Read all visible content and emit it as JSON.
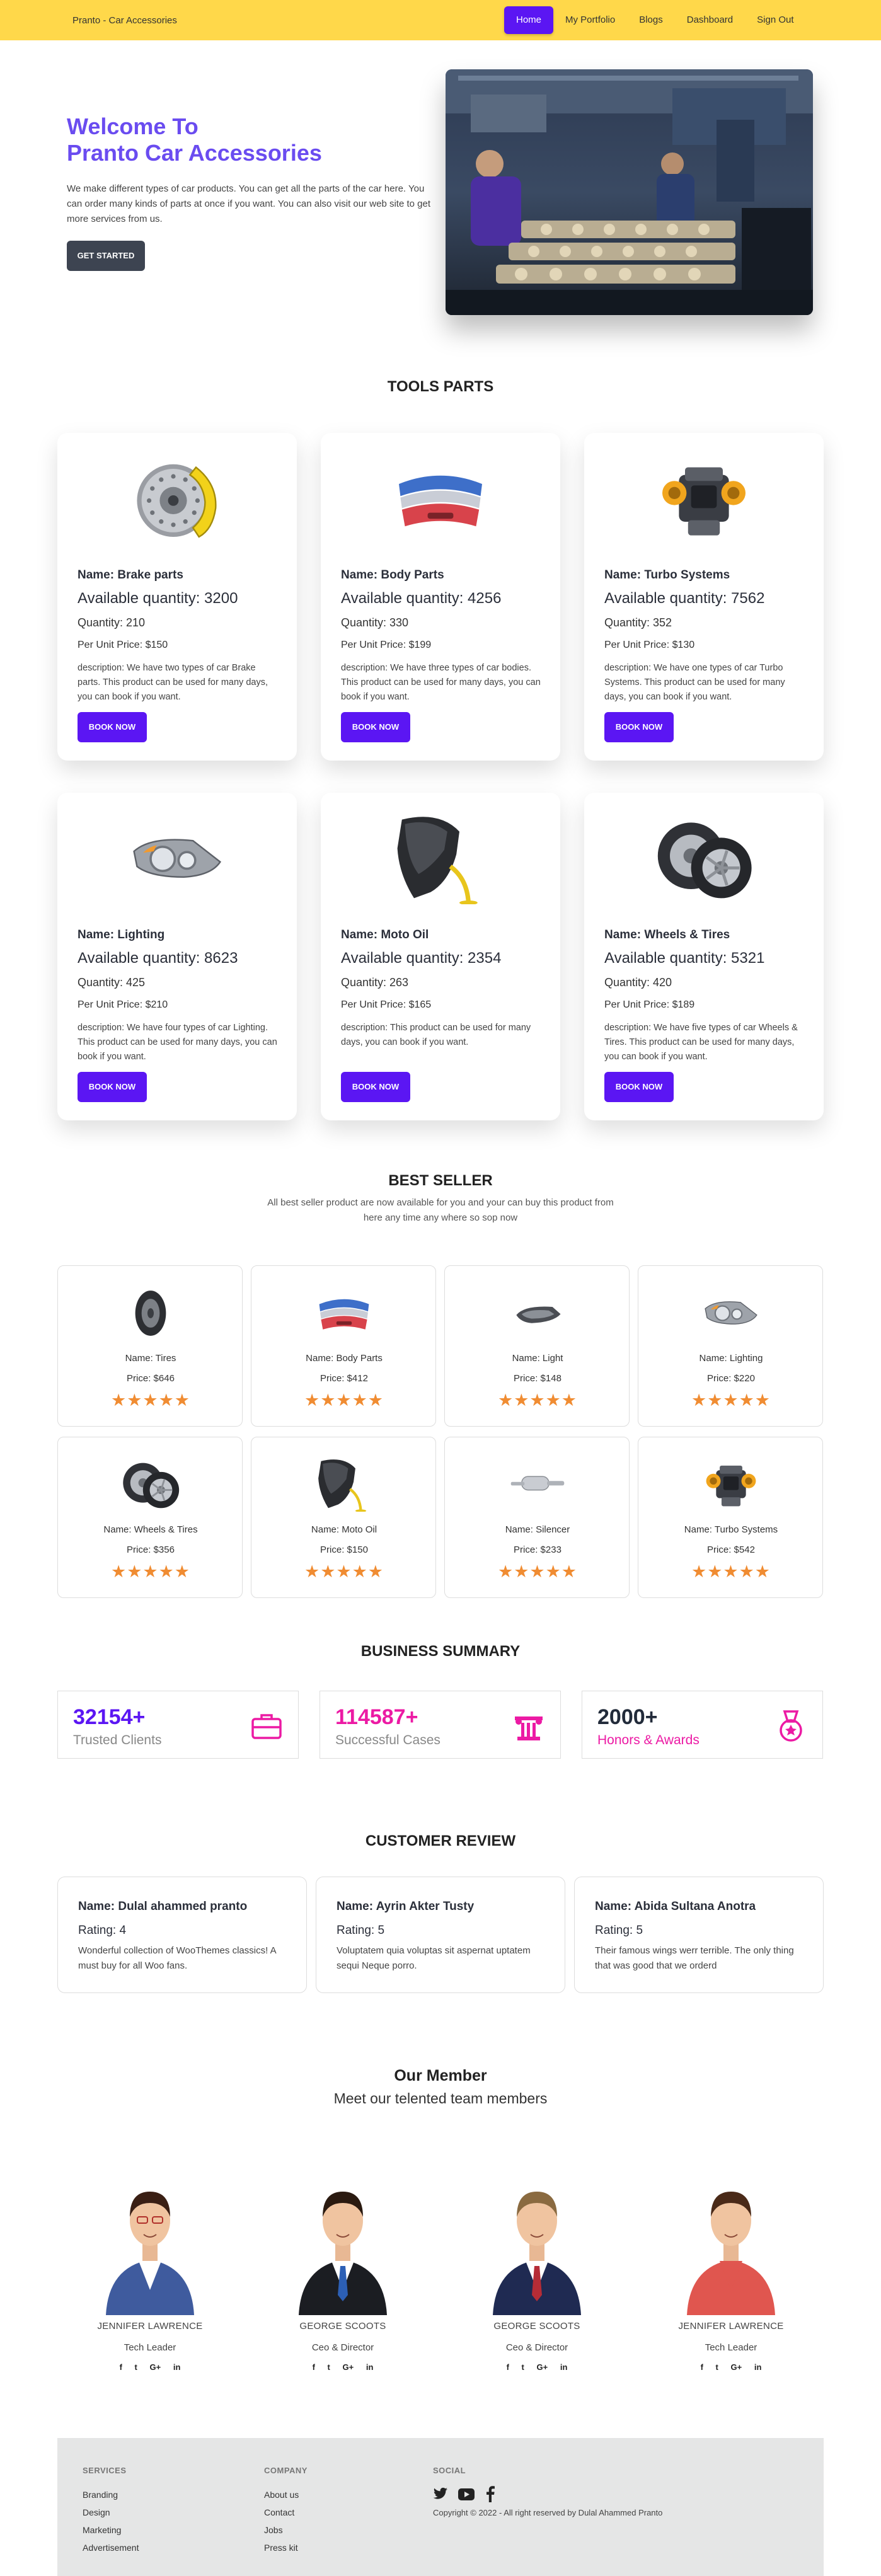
{
  "navbar": {
    "brand": "Pranto - Car Accessories",
    "links": [
      "Home",
      "My Portfolio",
      "Blogs",
      "Dashboard",
      "Sign Out"
    ]
  },
  "hero": {
    "title_line1": "Welcome To",
    "title_line2": "Pranto Car Accessories",
    "text": "We make different types of car products. You can get all the parts of the car here. You can order many kinds of parts at once if you want. You can also visit our web site to get more services from us.",
    "button": "GET STARTED"
  },
  "tools": {
    "title": "TOOLS PARTS",
    "button": "BOOK NOW",
    "items": [
      {
        "name": "Name: Brake parts",
        "available": "Available quantity: 3200",
        "quantity": "Quantity: 210",
        "price": "Per Unit Price: $150",
        "description": "description: We have two types of car Brake parts. This product can be used for many days, you can book if you want.",
        "icon": "brake-disc"
      },
      {
        "name": "Name: Body Parts",
        "available": "Available quantity: 4256",
        "quantity": "Quantity: 330",
        "price": "Per Unit Price: $199",
        "description": "description: We have three types of car bodies. This product can be used for many days, you can book if you want.",
        "icon": "bumpers"
      },
      {
        "name": "Name: Turbo Systems",
        "available": "Available quantity: 7562",
        "quantity": "Quantity: 352",
        "price": "Per Unit Price: $130",
        "description": "description: We have one types of car Turbo Systems. This product can be used for many days, you can book if you want.",
        "icon": "engine"
      },
      {
        "name": "Name: Lighting",
        "available": "Available quantity: 8623",
        "quantity": "Quantity: 425",
        "price": "Per Unit Price: $210",
        "description": "description: We have four types of car Lighting. This product can be used for many days, you can book if you want.",
        "icon": "headlight"
      },
      {
        "name": "Name: Moto Oil",
        "available": "Available quantity: 2354",
        "quantity": "Quantity: 263",
        "price": "Per Unit Price: $165",
        "description": "description: This product can be used for many days, you can book if you want.",
        "icon": "oil-pour"
      },
      {
        "name": "Name: Wheels & Tires",
        "available": "Available quantity: 5321",
        "quantity": "Quantity: 420",
        "price": "Per Unit Price: $189",
        "description": "description: We have five types of car Wheels & Tires. This product can be used for many days, you can book if you want.",
        "icon": "wheels"
      }
    ]
  },
  "best_seller": {
    "title": "BEST SELLER",
    "subtitle_line1": "All best seller product are now available for you and your can buy this product from",
    "subtitle_line2": "here any time any where so sop now",
    "stars": "★★★★★",
    "rating": 5,
    "items": [
      {
        "name": "Name: Tires",
        "price": "Price: $646",
        "icon": "tire"
      },
      {
        "name": "Name: Body Parts",
        "price": "Price: $412",
        "icon": "bumpers"
      },
      {
        "name": "Name: Light",
        "price": "Price: $148",
        "icon": "tail-light"
      },
      {
        "name": "Name: Lighting",
        "price": "Price: $220",
        "icon": "headlight"
      },
      {
        "name": "Name: Wheels & Tires",
        "price": "Price: $356",
        "icon": "wheels"
      },
      {
        "name": "Name: Moto Oil",
        "price": "Price: $150",
        "icon": "oil-pour"
      },
      {
        "name": "Name: Silencer",
        "price": "Price: $233",
        "icon": "silencer"
      },
      {
        "name": "Name: Turbo Systems",
        "price": "Price: $542",
        "icon": "engine"
      }
    ]
  },
  "summary": {
    "title": "BUSINESS SUMMARY",
    "items": [
      {
        "number": "32154+",
        "label": "Trusted Clients",
        "icon": "briefcase-icon",
        "color": "#5b16f3"
      },
      {
        "number": "114587+",
        "label": "Successful Cases",
        "icon": "column-icon",
        "color": "#ec1aa4"
      },
      {
        "number": "2000+",
        "label": "Honors & Awards",
        "icon": "medal-icon",
        "color": "#222b3a"
      }
    ]
  },
  "reviews": {
    "title": "CUSTOMER REVIEW",
    "items": [
      {
        "name": "Name: Dulal ahammed pranto",
        "rating": "Rating: 4",
        "text": "Wonderful collection of WooThemes classics! A must buy for all Woo fans."
      },
      {
        "name": "Name: Ayrin Akter Tusty",
        "rating": "Rating: 5",
        "text": "Voluptatem quia voluptas sit aspernat uptatem sequi Neque porro."
      },
      {
        "name": "Name: Abida Sultana Anotra",
        "rating": "Rating: 5",
        "text": "Their famous wings werr terrible. The only thing that was good that we orderd"
      }
    ]
  },
  "members": {
    "title": "Our Member",
    "subtitle": "Meet our telented team members",
    "social": [
      "f",
      "t",
      "G+",
      "in"
    ],
    "items": [
      {
        "name": "JENNIFER LAWRENCE",
        "role": "Tech Leader"
      },
      {
        "name": "GEORGE SCOOTS",
        "role": "Ceo & Director"
      },
      {
        "name": "GEORGE SCOOTS",
        "role": "Ceo & Director"
      },
      {
        "name": "JENNIFER LAWRENCE",
        "role": "Tech Leader"
      }
    ]
  },
  "footer": {
    "services": {
      "title": "SERVICES",
      "links": [
        "Branding",
        "Design",
        "Marketing",
        "Advertisement"
      ]
    },
    "company": {
      "title": "COMPANY",
      "links": [
        "About us",
        "Contact",
        "Jobs",
        "Press kit"
      ]
    },
    "social": {
      "title": "SOCIAL"
    },
    "copyright": "Copyright © 2022 - All right reserved by Dulal Ahammed Pranto"
  },
  "colors": {
    "navbar": "#ffd84a",
    "accent": "#5b16f3",
    "hero_title": "#6a4cf0",
    "pink": "#ec1aa4",
    "stars": "#f08c32"
  }
}
